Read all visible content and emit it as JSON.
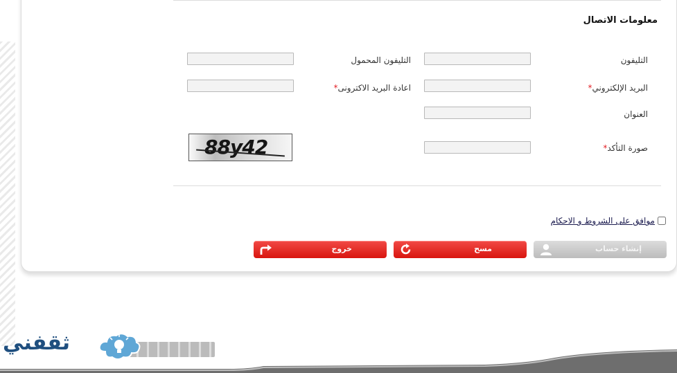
{
  "section": {
    "title": "معلومات الاتصال"
  },
  "form": {
    "phone_label": "التليفون",
    "mobile_label": "التليفون المحمول",
    "email_label": "البريد الإلكتروني",
    "email_confirm_label": "اعادة البريد الاكترونى",
    "address_label": "العنوان",
    "captcha_label": "صورة التأكد",
    "required_mark": "*",
    "phone_value": "",
    "mobile_value": "",
    "email_value": "",
    "email_confirm_value": "",
    "address_value": "",
    "captcha_value": "",
    "captcha_text": "88y42"
  },
  "terms": {
    "label": "موافق على الشروط و الاحكام",
    "checked": false
  },
  "buttons": {
    "create_account": "إنشاء حساب",
    "clear": "مسح",
    "exit": "خروج"
  },
  "icons": {
    "create": "user-icon",
    "clear": "refresh-icon",
    "exit": "arrow-forward-icon"
  },
  "watermark": {
    "text": "ثقفني"
  },
  "colors": {
    "accent_red": "#e31e24",
    "button_gray": "#c8c8c8",
    "watermark_blue": "#1f4f7f"
  }
}
